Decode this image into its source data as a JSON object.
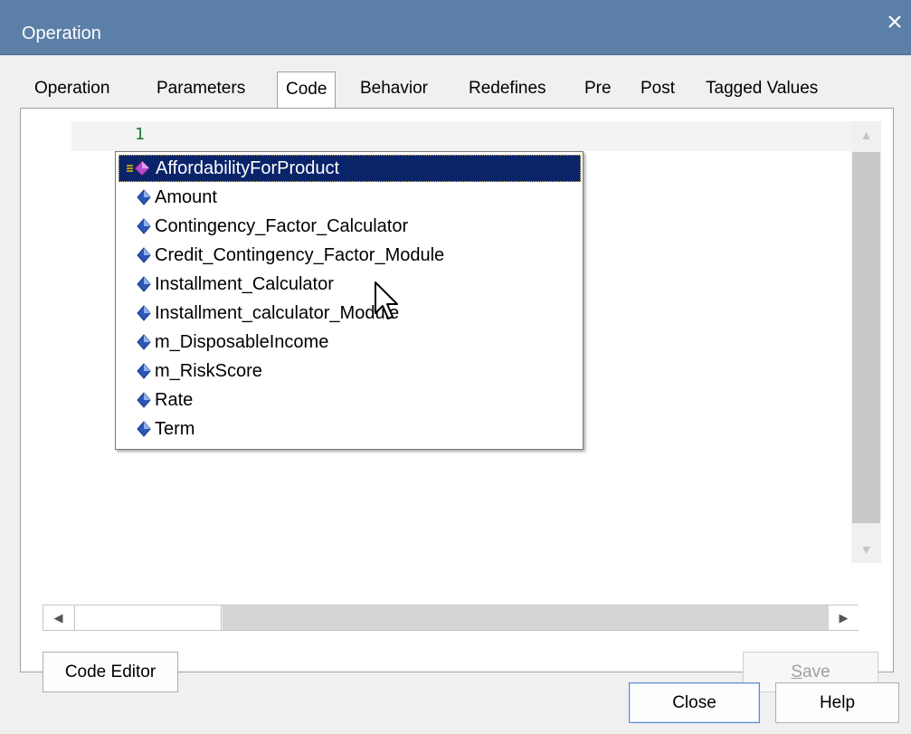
{
  "window": {
    "title": "Operation"
  },
  "tabs": [
    {
      "label": "Operation",
      "active": false
    },
    {
      "label": "Parameters",
      "active": false
    },
    {
      "label": "Code",
      "active": true
    },
    {
      "label": "Behavior",
      "active": false
    },
    {
      "label": "Redefines",
      "active": false
    },
    {
      "label": "Pre",
      "active": false
    },
    {
      "label": "Post",
      "active": false
    },
    {
      "label": "Tagged Values",
      "active": false
    }
  ],
  "editor": {
    "line_number": "1"
  },
  "autocomplete": {
    "items": [
      {
        "label": "AffordabilityForProduct",
        "icon": "method-icon",
        "selected": true
      },
      {
        "label": "Amount",
        "icon": "attribute-icon",
        "selected": false
      },
      {
        "label": "Contingency_Factor_Calculator",
        "icon": "attribute-icon",
        "selected": false
      },
      {
        "label": "Credit_Contingency_Factor_Module",
        "icon": "attribute-icon",
        "selected": false
      },
      {
        "label": "Installment_Calculator",
        "icon": "attribute-icon",
        "selected": false
      },
      {
        "label": "Installment_calculator_Module",
        "icon": "attribute-icon",
        "selected": false
      },
      {
        "label": "m_DisposableIncome",
        "icon": "attribute-icon",
        "selected": false
      },
      {
        "label": "m_RiskScore",
        "icon": "attribute-icon",
        "selected": false
      },
      {
        "label": "Rate",
        "icon": "attribute-icon",
        "selected": false
      },
      {
        "label": "Term",
        "icon": "attribute-icon",
        "selected": false
      }
    ]
  },
  "buttons": {
    "code_editor": "Code Editor",
    "save_prefix": "S",
    "save_rest": "ave",
    "close": "Close",
    "help": "Help"
  },
  "colors": {
    "titlebar": "#5b7fa6",
    "selection": "#0a246a",
    "line_number": "#1a7a3a"
  }
}
